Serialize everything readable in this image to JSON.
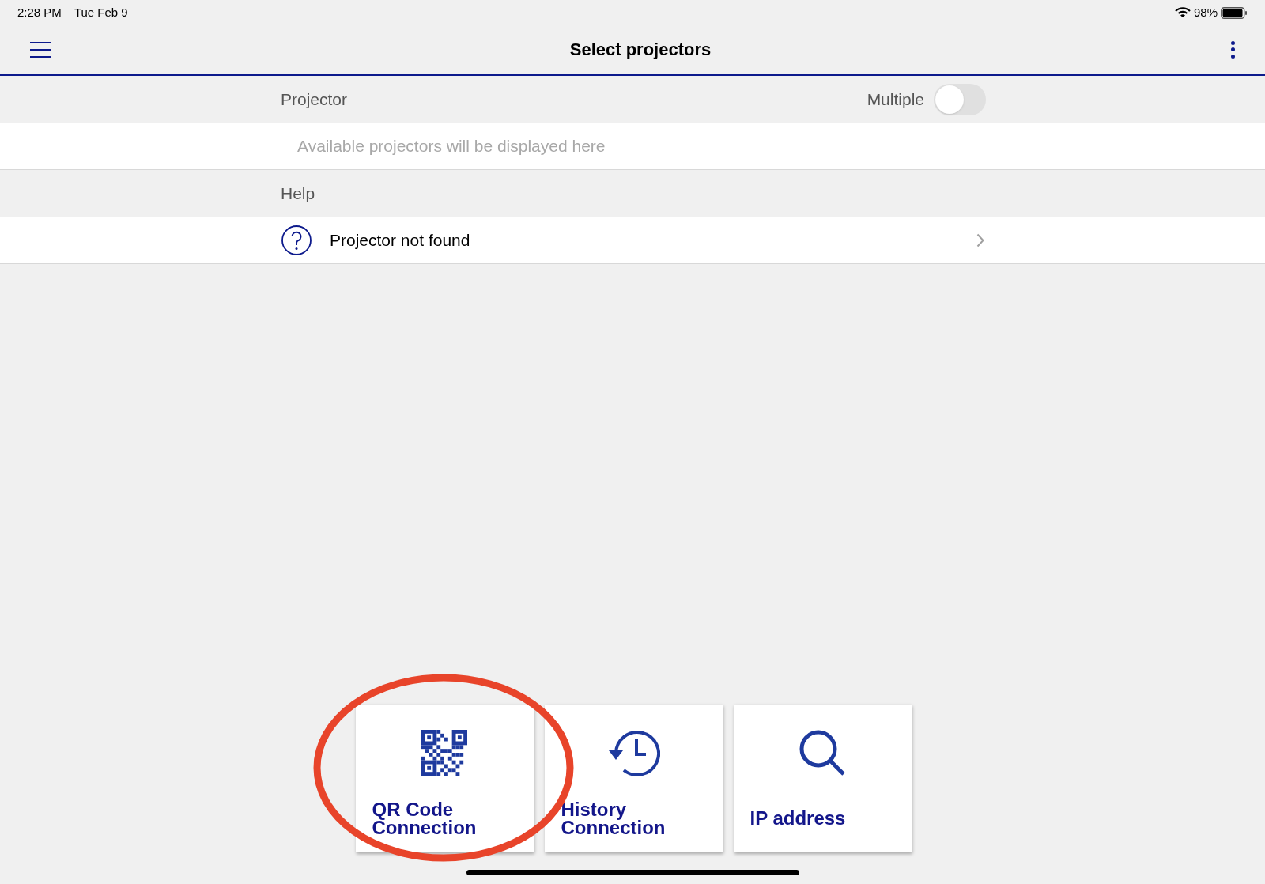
{
  "status_bar": {
    "time": "2:28 PM",
    "date": "Tue Feb 9",
    "battery": "98%"
  },
  "header": {
    "title": "Select projectors"
  },
  "projector_section": {
    "title": "Projector",
    "multiple_label": "Multiple",
    "multiple_on": false,
    "empty_text": "Available projectors will be displayed here"
  },
  "help_section": {
    "title": "Help",
    "items": [
      {
        "label": "Projector not found"
      }
    ]
  },
  "connection_cards": [
    {
      "kind": "qr",
      "label": "QR Code Connection",
      "highlighted": true
    },
    {
      "kind": "history",
      "label": "History Connection",
      "highlighted": false
    },
    {
      "kind": "search",
      "label": "IP address",
      "highlighted": false
    }
  ]
}
